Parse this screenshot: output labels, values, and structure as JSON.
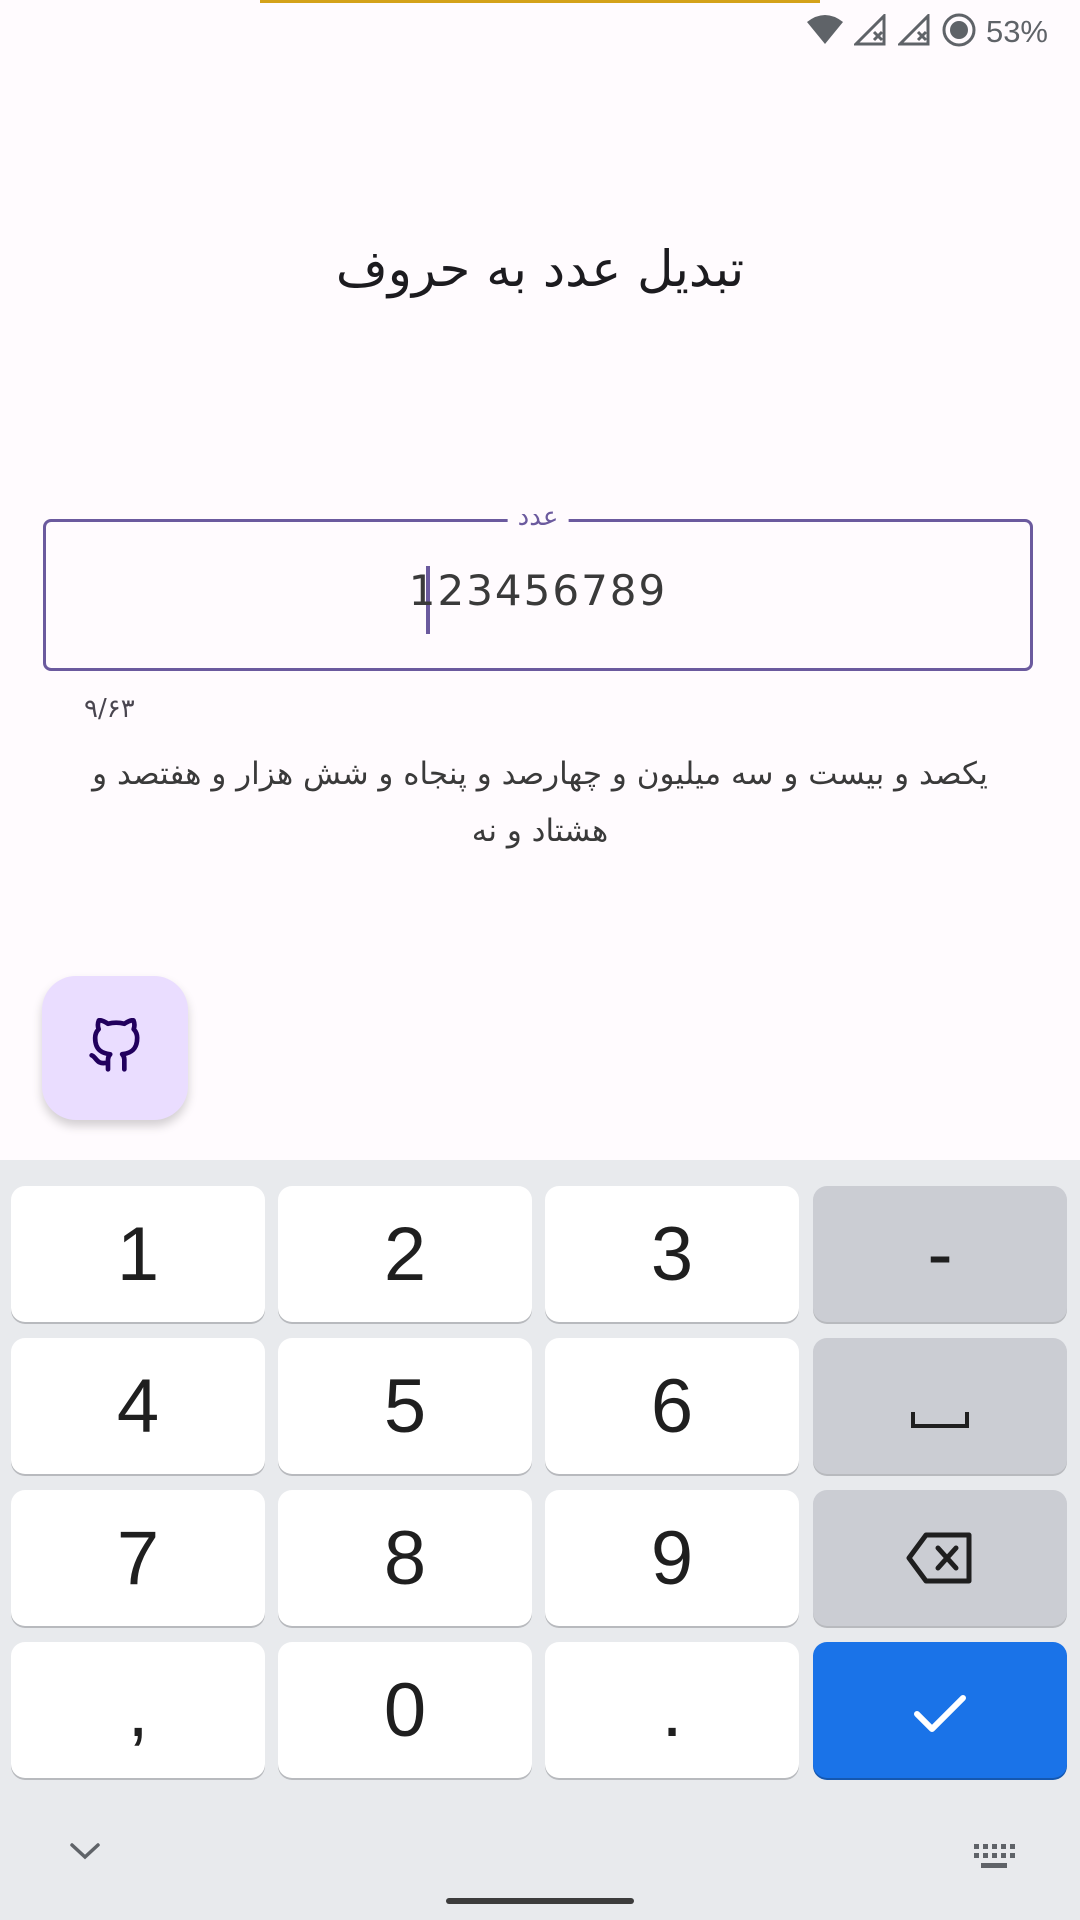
{
  "status_bar": {
    "battery": "53%"
  },
  "app": {
    "title": "تبدیل عدد به حروف",
    "field_label": "عدد",
    "field_value": "123456789",
    "counter": "۹/۶۳",
    "result_text": "یکصد و بیست و سه میلیون  و چهارصد و پنجاه و شش هزار  و هفتصد و هشتاد و نه"
  },
  "keyboard": {
    "keys": {
      "k1": "1",
      "k2": "2",
      "k3": "3",
      "minus": "-",
      "k4": "4",
      "k5": "5",
      "k6": "6",
      "k7": "7",
      "k8": "8",
      "k9": "9",
      "comma": ",",
      "k0": "0",
      "period": "."
    }
  },
  "colors": {
    "accent": "#6b5a9e",
    "fab_bg": "#eaddff",
    "enter_key": "#1a73e8",
    "top_accent": "#d4a21a"
  },
  "icons": [
    "wifi-icon",
    "signal-off-icon",
    "signal-off-icon",
    "dnd-icon",
    "github-icon",
    "space-icon",
    "backspace-icon",
    "check-icon",
    "chevron-down-icon",
    "keyboard-icon"
  ]
}
